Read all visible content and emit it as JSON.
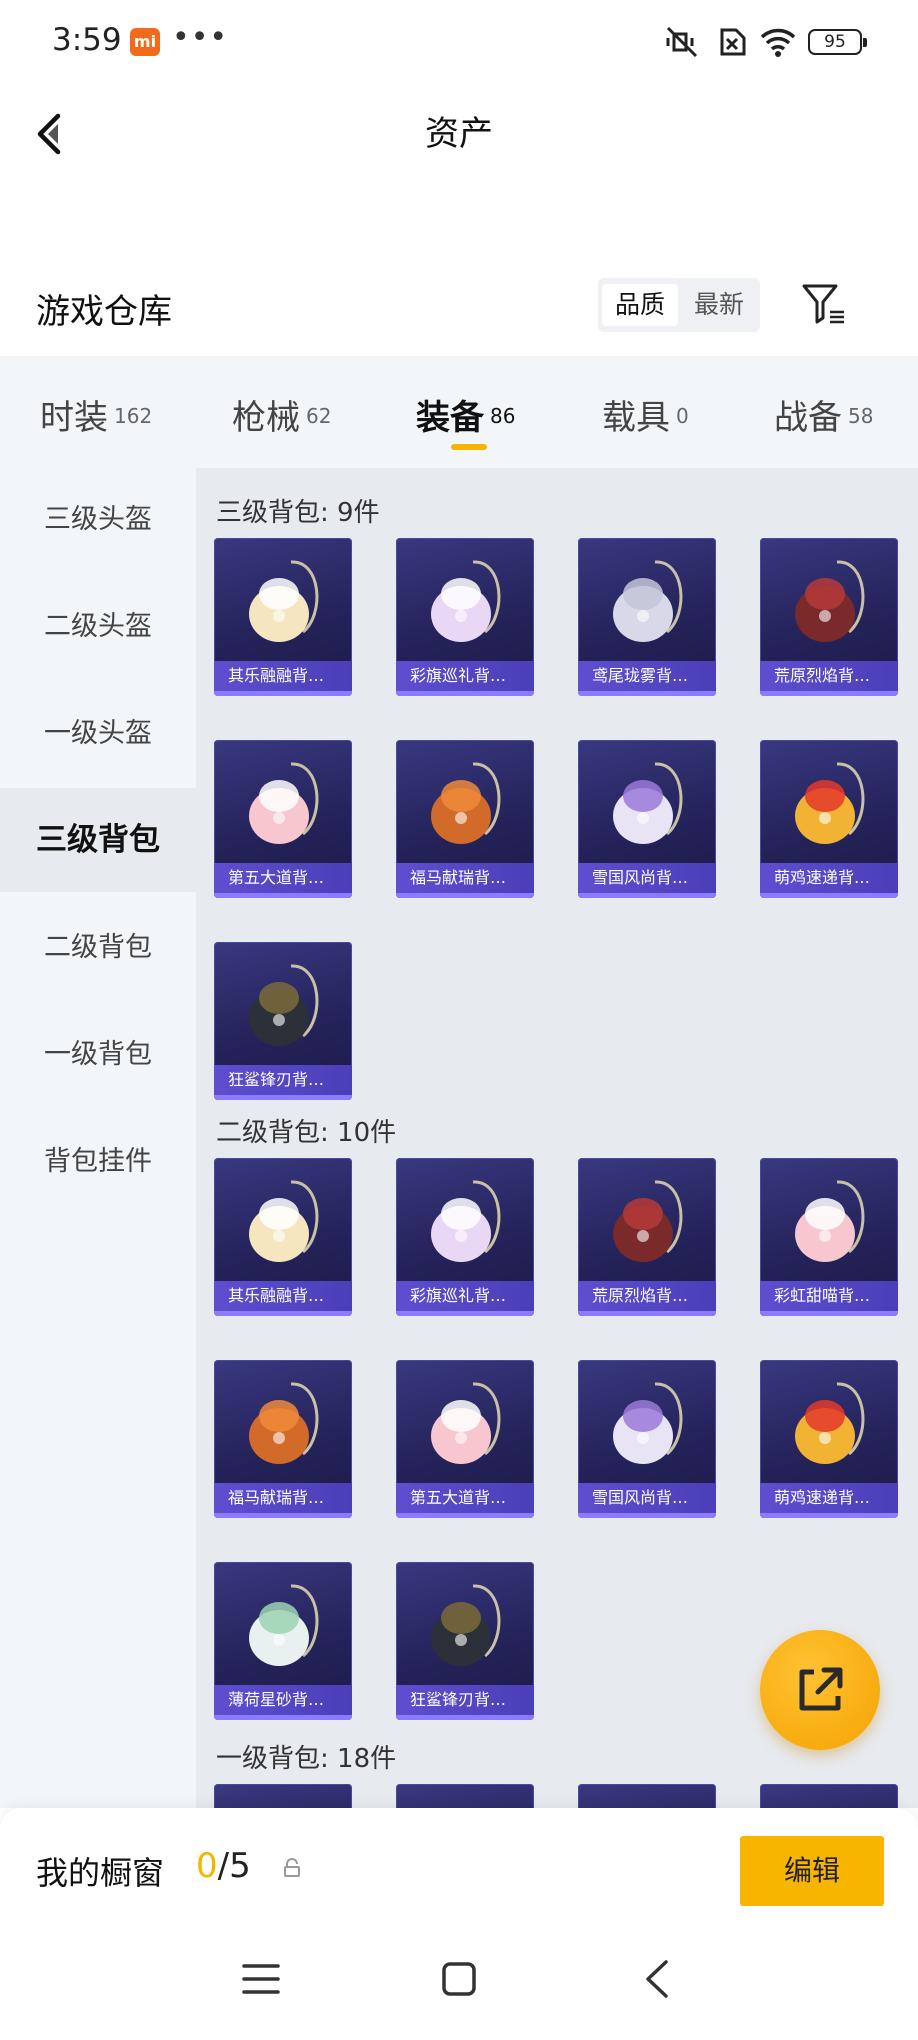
{
  "status_bar": {
    "time": "3:59",
    "app_badge": "mi",
    "more": "•••",
    "battery": "95"
  },
  "header": {
    "title": "资产"
  },
  "warehouse": {
    "title": "游戏仓库",
    "sort_options": [
      "品质",
      "最新"
    ],
    "selected_sort": "品质"
  },
  "tabs": [
    {
      "name": "时装",
      "count": "162"
    },
    {
      "name": "枪械",
      "count": "62"
    },
    {
      "name": "装备",
      "count": "86",
      "active": true
    },
    {
      "name": "载具",
      "count": "0"
    },
    {
      "name": "战备",
      "count": "58"
    }
  ],
  "sidebar": [
    "三级头盔",
    "二级头盔",
    "一级头盔",
    "三级背包",
    "二级背包",
    "一级背包",
    "背包挂件"
  ],
  "sidebar_active": "三级背包",
  "sections": [
    {
      "title": "三级背包: 9件",
      "items": [
        "其乐融融背…",
        "彩旗巡礼背…",
        "鸢尾珑雾背…",
        "荒原烈焰背…",
        "第五大道背…",
        "福马献瑞背…",
        "雪国风尚背…",
        "萌鸡速递背…",
        "狂鲨锋刃背…"
      ]
    },
    {
      "title": "二级背包: 10件",
      "items": [
        "其乐融融背…",
        "彩旗巡礼背…",
        "荒原烈焰背…",
        "彩虹甜喵背…",
        "福马献瑞背…",
        "第五大道背…",
        "雪国风尚背…",
        "萌鸡速递背…",
        "薄荷星砂背…",
        "狂鲨锋刃背…"
      ]
    },
    {
      "title": "一级背包: 18件",
      "items": []
    }
  ],
  "showcase": {
    "label": "我的橱窗",
    "count": "0",
    "total": "/5",
    "edit_label": "编辑"
  },
  "colors": {
    "accent": "#f5b400",
    "card_bg": "#24235a",
    "card_label": "#5d4fcf"
  },
  "icons": {
    "back": "back-arrow-icon",
    "filter": "filter-icon",
    "share": "share-icon",
    "lock": "lock-icon"
  }
}
